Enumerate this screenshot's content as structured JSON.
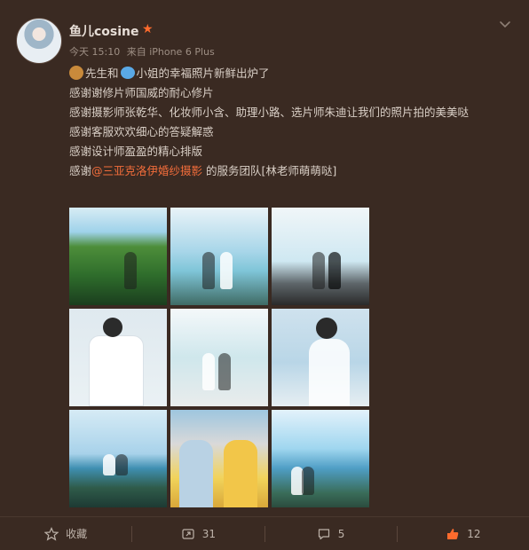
{
  "post": {
    "user": {
      "name": "鱼儿cosine"
    },
    "meta": {
      "time": "今天 15:10",
      "source": "来自 iPhone 6 Plus"
    },
    "content": {
      "line1": "先生和",
      "line1b": "小姐的幸福照片新鲜出炉了",
      "line2": "感谢谢修片师国威的耐心修片",
      "line3": "感谢摄影师张乾华、化妆师小含、助理小路、选片师朱迪让我们的照片拍的美美哒",
      "line4": "感谢客服欢欢细心的答疑解惑",
      "line5": "感谢设计师盈盈的精心排版",
      "line6_prefix": "感谢",
      "mention": "@三亚克洛伊婚纱摄影",
      "line6_suffix": " 的服务团队[林老师萌萌哒]"
    },
    "emojis": [
      "bear-emoji",
      "fish-emoji"
    ]
  },
  "actions": {
    "favorite": {
      "label": "收藏"
    },
    "repost": {
      "count": "31"
    },
    "comment": {
      "count": "5"
    },
    "like": {
      "count": "12"
    }
  },
  "colors": {
    "background": "#3a2a22",
    "mention": "#f36d3b",
    "like": "#ff6b2d"
  }
}
